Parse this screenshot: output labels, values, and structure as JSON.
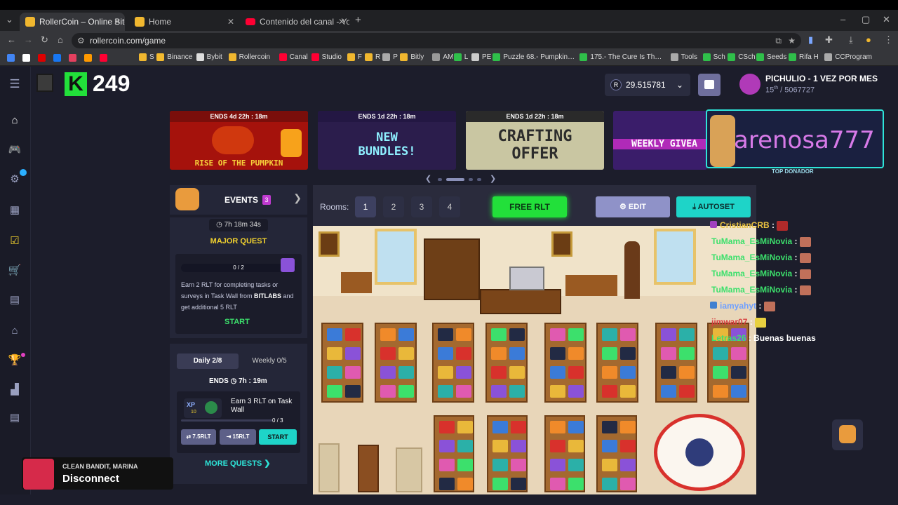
{
  "browser": {
    "tabs": [
      {
        "label": "RollerCoin – Online Bitcoin Mi…",
        "color": "#f0b72f"
      },
      {
        "label": "Home",
        "color": "#f0b72f"
      },
      {
        "label": "Contenido del canal - YouTube",
        "color": "#ff0033"
      }
    ],
    "url": "rollercoin.com/game",
    "bookmarks": [
      "S",
      "Binance",
      "Bybit",
      "Rollercoin",
      "Canal",
      "Studio",
      "F",
      "R",
      "P",
      "Bitly",
      "AM",
      "L",
      "PE",
      "Puzzle 68.- Pumpkin…",
      "175.- The Cure Is Th…",
      "Tools",
      "Sch",
      "CSch",
      "Seeds",
      "Rifa H",
      "CCProgram"
    ]
  },
  "header": {
    "level": "249",
    "balance": "29.515781",
    "username": "PICHULIO - 1 VEZ POR MES",
    "rank_num": "15",
    "rank_sup": "th",
    "rank_total": "/ 5067727"
  },
  "banners": [
    {
      "ends": "ENDS  4d 22h : 18m",
      "title": "RISE OF THE PUMPKIN",
      "bg": "#a5120c"
    },
    {
      "ends": "ENDS  1d 22h : 18m",
      "title": "NEW BUNDLES!",
      "bg": "#2b1d4c"
    },
    {
      "ends": "ENDS  1d 22h : 18m",
      "title": "CRAFTING OFFER",
      "bg": "#c9c6a2"
    },
    {
      "ends": "",
      "title": "WEEKLY GIVEA",
      "bg": "#3a1d6a"
    }
  ],
  "overlay": {
    "donor_name": "arenosa777",
    "donor_label": "TOP DONADOR"
  },
  "events": {
    "title": "EVENTS",
    "count": "3",
    "timer": "7h 18m 34s",
    "quest_title": "MAJOR QUEST",
    "progress": "0 / 2",
    "progress_fraction": 0,
    "desc_1": "Earn 2 RLT for completing tasks or surveys in Task Wall from ",
    "desc_brand": "BITLABS",
    "desc_2": " and get additional 5 RLT",
    "start": "START"
  },
  "daily": {
    "tab_daily": "Daily  2/8",
    "tab_weekly": "Weekly  0/5",
    "ends": "ENDS",
    "ends_time": "7h : 19m",
    "xp_amount": "10",
    "task": "Earn 3 RLT on Task Wall",
    "task_progress": "0 / 3",
    "btn_a": "⇄ 7.5RLT",
    "btn_b": "⇥ 15RLT",
    "start": "START",
    "more": "MORE QUESTS"
  },
  "game": {
    "rooms_label": "Rooms:",
    "rooms": [
      "1",
      "2",
      "3",
      "4"
    ],
    "free_rlt": "FREE RLT",
    "edit": "EDIT",
    "autoset": "AUTOSET"
  },
  "chat": [
    {
      "user": "CristianCRB",
      "msg": "",
      "color": "#e8c040"
    },
    {
      "user": "TuMama_EsMiNovia",
      "msg": "",
      "color": "#3ce06c"
    },
    {
      "user": "TuMama_EsMiNovia",
      "msg": "",
      "color": "#3ce06c"
    },
    {
      "user": "TuMama_EsMiNovia",
      "msg": "",
      "color": "#3ce06c"
    },
    {
      "user": "TuMama_EsMiNovia",
      "msg": "",
      "color": "#3ce06c"
    },
    {
      "user": "iamyahyt",
      "msg": "",
      "color": "#6fa0ff"
    },
    {
      "user": "jimwar07",
      "msg": "",
      "color": "#d84040"
    },
    {
      "user": "Letras26",
      "msg": "Buenas buenas",
      "color": "#3ce06c"
    }
  ],
  "toast": {
    "artist": "CLEAN BANDIT, MARINA",
    "track": "Disconnect"
  }
}
